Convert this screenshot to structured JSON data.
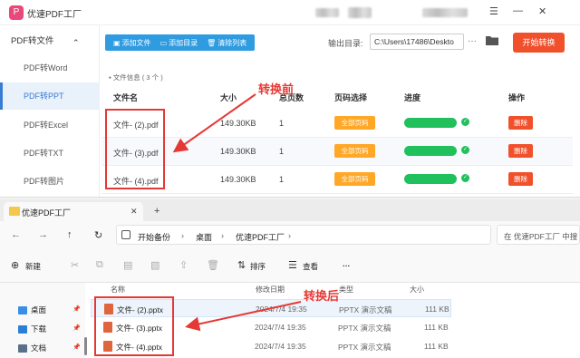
{
  "app": {
    "logo_glyph": "P",
    "title": "优速PDF工厂",
    "window_controls": {
      "menu": "☰",
      "minimize": "—",
      "close": "✕"
    }
  },
  "sidebar": {
    "header": "PDF转文件",
    "header_chevron": "⌃",
    "items": [
      {
        "label": "PDF转Word",
        "active": false
      },
      {
        "label": "PDF转PPT",
        "active": true
      },
      {
        "label": "PDF转Excel",
        "active": false
      },
      {
        "label": "PDF转TXT",
        "active": false
      },
      {
        "label": "PDF转图片",
        "active": false
      }
    ]
  },
  "toolbar": {
    "add_file": "添加文件",
    "add_dir": "添加目录",
    "clear_list": "清除列表"
  },
  "output": {
    "label": "输出目录:",
    "path": "C:\\Users\\17486\\Deskto",
    "more": "···"
  },
  "start_button": "开始转换",
  "file_info": {
    "label": "文件信息",
    "count": "( 3 个 )"
  },
  "table": {
    "headers": {
      "name": "文件名",
      "size": "大小",
      "pages": "总页数",
      "page_select": "页码选择",
      "progress": "进度",
      "action": "操作"
    },
    "rows": [
      {
        "name": "文件- (2).pdf",
        "size": "149.30KB",
        "pages": "1",
        "page_select": "全部页码",
        "progress": 1.0,
        "check": "✓",
        "action": "删除"
      },
      {
        "name": "文件- (3).pdf",
        "size": "149.30KB",
        "pages": "1",
        "page_select": "全部页码",
        "progress": 1.0,
        "check": "✓",
        "action": "删除"
      },
      {
        "name": "文件- (4).pdf",
        "size": "149.30KB",
        "pages": "1",
        "page_select": "全部页码",
        "progress": 1.0,
        "check": "✓",
        "action": "删除"
      }
    ]
  },
  "annotations": {
    "before": "转换前",
    "after": "转换后"
  },
  "explorer": {
    "tab_title": "优速PDF工厂",
    "tab_close": "✕",
    "tab_add": "+",
    "nav": {
      "back": "←",
      "forward": "→",
      "up": "↑",
      "refresh": "↻"
    },
    "breadcrumb": [
      "开始备份",
      "桌面",
      "优速PDF工厂"
    ],
    "breadcrumb_sep": "›",
    "search_placeholder": "在 优速PDF工厂 中搜",
    "commands": {
      "new": "新建",
      "sort": "排序",
      "view": "查看",
      "more": "···"
    },
    "left_nav": [
      {
        "label": "桌面",
        "color": "#3a8ee6"
      },
      {
        "label": "下载",
        "color": "#2b7fd6"
      },
      {
        "label": "文档",
        "color": "#5a6f8a"
      }
    ],
    "pin": "📌",
    "columns": {
      "name": "名称",
      "modified": "修改日期",
      "type": "类型",
      "size": "大小"
    },
    "files": [
      {
        "name": "文件- (2).pptx",
        "modified": "2024/7/4 19:35",
        "type": "PPTX 演示文稿",
        "size": "111 KB"
      },
      {
        "name": "文件- (3).pptx",
        "modified": "2024/7/4 19:35",
        "type": "PPTX 演示文稿",
        "size": "111 KB"
      },
      {
        "name": "文件- (4).pptx",
        "modified": "2024/7/4 19:35",
        "type": "PPTX 演示文稿",
        "size": "111 KB"
      }
    ]
  },
  "colors": {
    "accent_blue": "#2f9be0",
    "start_red": "#f0502c",
    "progress_green": "#20c05c",
    "page_orange": "#ffa726",
    "annotation_red": "#e53935"
  }
}
